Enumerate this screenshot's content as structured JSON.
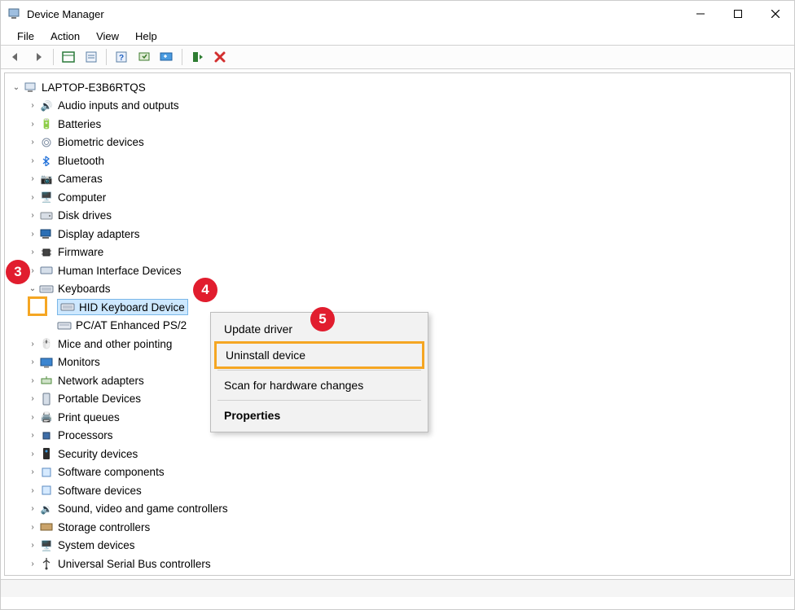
{
  "window": {
    "title": "Device Manager"
  },
  "menu": {
    "file": "File",
    "action": "Action",
    "view": "View",
    "help": "Help"
  },
  "tree": {
    "root": "LAPTOP-E3B6RTQS",
    "items": {
      "audio": "Audio inputs and outputs",
      "batt": "Batteries",
      "bio": "Biometric devices",
      "bt": "Bluetooth",
      "cam": "Cameras",
      "comp": "Computer",
      "disk": "Disk drives",
      "disp": "Display adapters",
      "fw": "Firmware",
      "hid": "Human Interface Devices",
      "kbd": "Keyboards",
      "kbd_hid": "HID Keyboard Device",
      "kbd_ps2": "PC/AT Enhanced PS/2",
      "mice": "Mice and other pointing",
      "mon": "Monitors",
      "net": "Network adapters",
      "port": "Portable Devices",
      "printq": "Print queues",
      "proc": "Processors",
      "sec": "Security devices",
      "swcomp": "Software components",
      "swdev": "Software devices",
      "sound": "Sound, video and game controllers",
      "storage": "Storage controllers",
      "sys": "System devices",
      "usb": "Universal Serial Bus controllers"
    }
  },
  "context_menu": {
    "update": "Update driver",
    "uninstall": "Uninstall device",
    "scan": "Scan for hardware changes",
    "properties": "Properties"
  },
  "annotations": {
    "a3": "3",
    "a4": "4",
    "a5": "5"
  }
}
